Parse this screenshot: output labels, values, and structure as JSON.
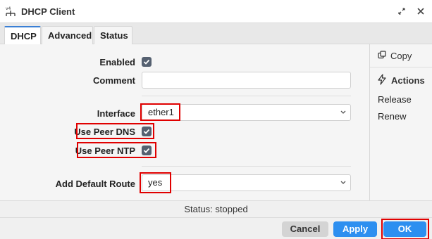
{
  "window": {
    "title": "DHCP Client",
    "icon": "network-v4-icon"
  },
  "tabs": [
    {
      "label": "DHCP",
      "active": true
    },
    {
      "label": "Advanced",
      "active": false
    },
    {
      "label": "Status",
      "active": false
    }
  ],
  "form": {
    "enabled_label": "Enabled",
    "enabled_checked": true,
    "comment_label": "Comment",
    "comment_value": "",
    "interface_label": "Interface",
    "interface_value": "ether1",
    "use_peer_dns_label": "Use Peer DNS",
    "use_peer_dns_checked": true,
    "use_peer_ntp_label": "Use Peer NTP",
    "use_peer_ntp_checked": true,
    "default_route_label": "Add Default Route",
    "default_route_value": "yes"
  },
  "sidebar": {
    "copy_label": "Copy",
    "actions_label": "Actions",
    "release_label": "Release",
    "renew_label": "Renew"
  },
  "status": {
    "text": "Status: stopped"
  },
  "footer": {
    "cancel_label": "Cancel",
    "apply_label": "Apply",
    "ok_label": "OK"
  },
  "colors": {
    "highlight": "#e00000",
    "primary_button": "#2d8ff0",
    "checkbox": "#556070",
    "tab_active_border": "#3a7fd5"
  }
}
